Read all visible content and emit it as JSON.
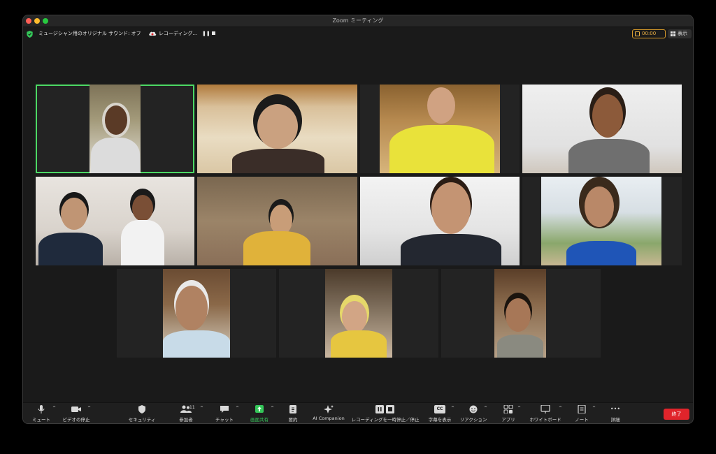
{
  "window": {
    "title": "Zoom ミーティング"
  },
  "infobar": {
    "music_mode": "ミュージシャン用のオリジナル サウンド: オフ",
    "recording": "レコーディング...",
    "pause_glyph": "❚❚",
    "timer": "00:00",
    "view": "表示"
  },
  "participants": [
    {
      "id": "p1",
      "active": true
    },
    {
      "id": "p2",
      "active": false
    },
    {
      "id": "p3",
      "active": false
    },
    {
      "id": "p4",
      "active": false
    },
    {
      "id": "p5",
      "active": false
    },
    {
      "id": "p6",
      "active": false
    },
    {
      "id": "p7",
      "active": false
    },
    {
      "id": "p8",
      "active": false
    },
    {
      "id": "p9",
      "active": false
    },
    {
      "id": "p10",
      "active": false
    },
    {
      "id": "p11",
      "active": false
    }
  ],
  "toolbar": {
    "mute": "ミュート",
    "video": "ビデオの停止",
    "security": "セキュリティ",
    "participants": "参加者",
    "participants_count": "11",
    "chat": "チャット",
    "share": "画面共有",
    "summary": "要約",
    "ai": "AI Companion",
    "record": "レコーディングを一時停止／停止",
    "captions": "字幕を表示",
    "reactions": "リアクション",
    "apps": "アプリ",
    "whiteboard": "ホワイトボード",
    "notes": "ノート",
    "more": "詳細",
    "end": "終了",
    "cc_glyph": "CC",
    "more_glyph": "•••"
  },
  "colors": {
    "active_speaker": "#4cd964",
    "end_button": "#e0242b",
    "share_green": "#34c759",
    "timer_orange": "#f0b445"
  }
}
